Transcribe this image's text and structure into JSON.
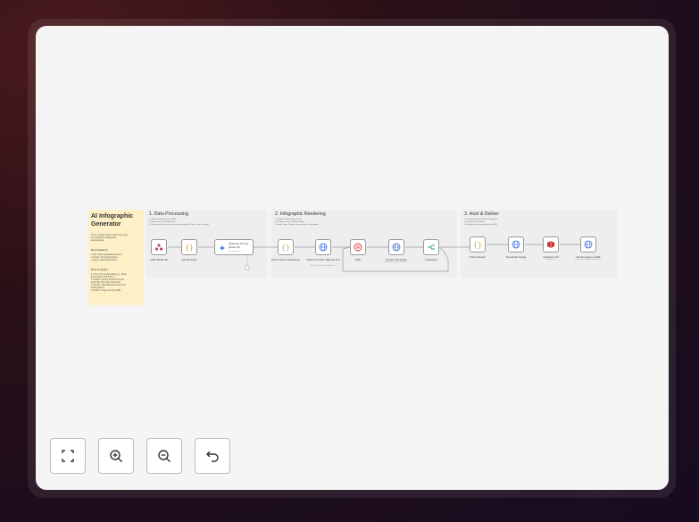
{
  "sticky": {
    "title": "AI Infographic Generator",
    "intro": [
      "Turns complex data or topics into easy-",
      "to-understand infographics",
      "automatically."
    ],
    "features_heading": "Key Features",
    "features": [
      "• Role: Data Visualization Expert",
      "• Format: 3:4 Vertical Poster",
      "• Engine: Nano Banana Pro"
    ],
    "how_heading": "How it works",
    "steps": [
      "1. Input: User sends data (e.g., Japan",
      "   Energy Mix, 20% Solar...)",
      "2. Design: Gemini decides the best",
      "   chart type (Pie, Bar, Flowchart)",
      "3. Render: Nano Banana creates the",
      "   visual graphic",
      "4. Deliver: Image sent via LINE."
    ]
  },
  "sections": [
    {
      "title": "1. Data Processing",
      "lines": [
        "1. Extract data/topic from LINE",
        "2. Gemini acts as Data Analyst",
        "3. Structures the data into a visual description (Charts, Icons, Layout)"
      ]
    },
    {
      "title": "2. Infographic Rendering",
      "lines": [
        "1. Submit to Nano Banana Pro",
        "2. Configured for 3:4 Aspect Ratio",
        "3. Smart Loop: Checks status every 5s until ready"
      ]
    },
    {
      "title": "3. Host & Deliver",
      "lines": [
        "1. Download the generated Infographic",
        "2. Upload to S3 (Public)",
        "3. Send the visual report back to LINE"
      ]
    }
  ],
  "nodes": {
    "line_webhook": {
      "label": "LINE Webhook",
      "icon": "webhook-icon"
    },
    "extract_data": {
      "label": "Extract Data",
      "icon": "code-braces-icon"
    },
    "optimize_prompt": {
      "label": "Optimize Prompt (Data Viz)",
      "sub": "message: text",
      "icon": "gemini-sparkle-icon"
    },
    "parse_gemini": {
      "label": "Parse Gemini Response",
      "icon": "code-braces-icon"
    },
    "submit_nano": {
      "label": "Submit to Nano Banana Pro",
      "sub": "POST: https://api.kie.ai/api/v1/...",
      "icon": "globe-icon"
    },
    "wait": {
      "label": "Wait",
      "icon": "pause-icon"
    },
    "check_job": {
      "label": "Check Job Status",
      "sub": "GET: https://api.kie.ai/api/v1/...",
      "icon": "globe-icon"
    },
    "is_ready": {
      "label": "Is Ready?",
      "icon": "branch-icon"
    },
    "parse_result": {
      "label": "Parse Result",
      "icon": "code-braces-icon"
    },
    "download_image": {
      "label": "Download Image",
      "icon": "globe-icon"
    },
    "upload_s3": {
      "label": "Upload to S3",
      "sub": "upload: file",
      "icon": "s3-icon"
    },
    "send_line": {
      "label": "Send Image to LINE",
      "sub": "POST: https://api.line.me/v2/bot/...",
      "icon": "globe-icon"
    }
  },
  "controls": [
    {
      "name": "fit-view-button",
      "icon": "fit-view-icon"
    },
    {
      "name": "zoom-in-button",
      "icon": "zoom-in-icon"
    },
    {
      "name": "zoom-out-button",
      "icon": "zoom-out-icon"
    },
    {
      "name": "undo-button",
      "icon": "undo-icon"
    }
  ],
  "colors": {
    "background": "#2b1016",
    "canvas": "#f5f5f5",
    "sticky": "#fdf0c7",
    "accent_orange": "#e8a33b",
    "accent_blue": "#3b6fe0",
    "accent_red": "#d0312d"
  }
}
